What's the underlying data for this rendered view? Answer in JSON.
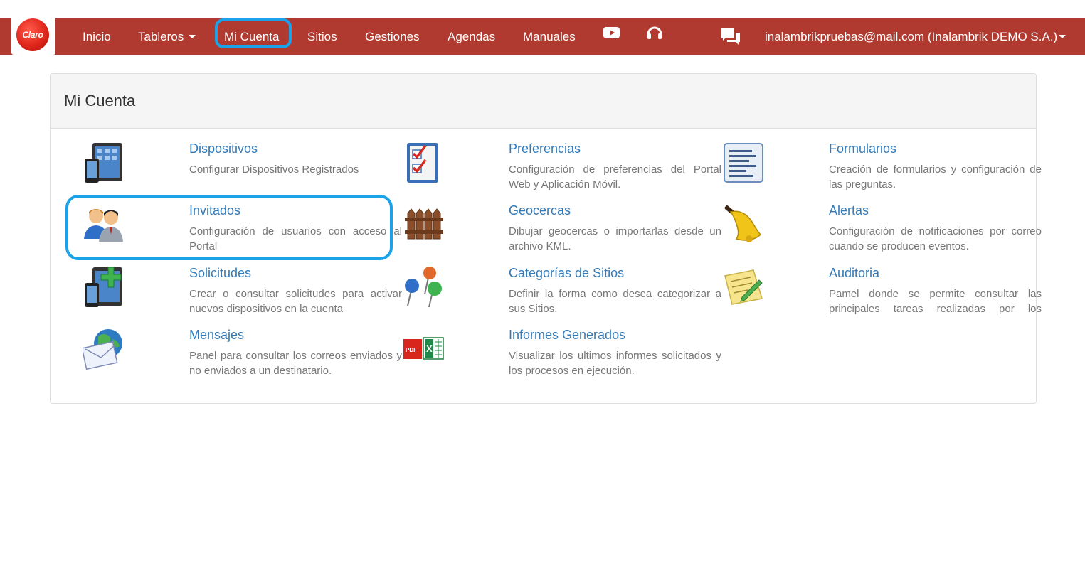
{
  "brand": {
    "logo_text": "Claro"
  },
  "nav": {
    "items": [
      {
        "label": "Inicio"
      },
      {
        "label": "Tableros"
      },
      {
        "label": "Mi Cuenta"
      },
      {
        "label": "Sitios"
      },
      {
        "label": "Gestiones"
      },
      {
        "label": "Agendas"
      },
      {
        "label": "Manuales"
      }
    ],
    "youtube_icon": "youtube-icon",
    "support_icon": "headset-icon",
    "chat_icon": "chat-icon",
    "user": "inalambrikpruebas@mail.com (Inalambrik DEMO S.A.)"
  },
  "page": {
    "title": "Mi Cuenta"
  },
  "items": [
    {
      "title": "Dispositivos",
      "desc": "Configurar Dispositivos Registrados",
      "icon": "devices-icon"
    },
    {
      "title": "Preferencias",
      "desc": "Configuración de preferencias del Portal Web y Aplicación Móvil.",
      "icon": "checklist-icon"
    },
    {
      "title": "Formularios",
      "desc": "Creación de formularios y configuración de las preguntas.",
      "icon": "form-icon"
    },
    {
      "title": "Invitados",
      "desc": "Configuración de usuarios con acceso al Portal",
      "icon": "users-icon"
    },
    {
      "title": "Geocercas",
      "desc": "Dibujar geocercas o importarlas desde un archivo KML.",
      "icon": "fence-icon"
    },
    {
      "title": "Alertas",
      "desc": "Configuración de notificaciones por correo cuando se producen eventos.",
      "icon": "bell-icon"
    },
    {
      "title": "Solicitudes",
      "desc": "Crear o consultar solicitudes para activar nuevos dispositivos en la cuenta",
      "icon": "add-device-icon"
    },
    {
      "title": "Categorías de Sitios",
      "desc": "Definir la forma como desea categorizar a sus Sitios.",
      "icon": "pins-icon"
    },
    {
      "title": "Auditoria",
      "desc": "Pamel donde se permite consultar las principales tareas realizadas por los usuarios",
      "icon": "audit-icon"
    },
    {
      "title": "Mensajes",
      "desc": "Panel para consultar los correos enviados y no enviados a un destinatario.",
      "icon": "mail-icon"
    },
    {
      "title": "Informes Generados",
      "desc": "Visualizar los ultimos informes solicitados y los procesos en ejecución.",
      "icon": "reports-icon"
    }
  ],
  "colors": {
    "navbar": "#b13a30",
    "link": "#337ab7",
    "highlight": "#1aa3e8"
  }
}
